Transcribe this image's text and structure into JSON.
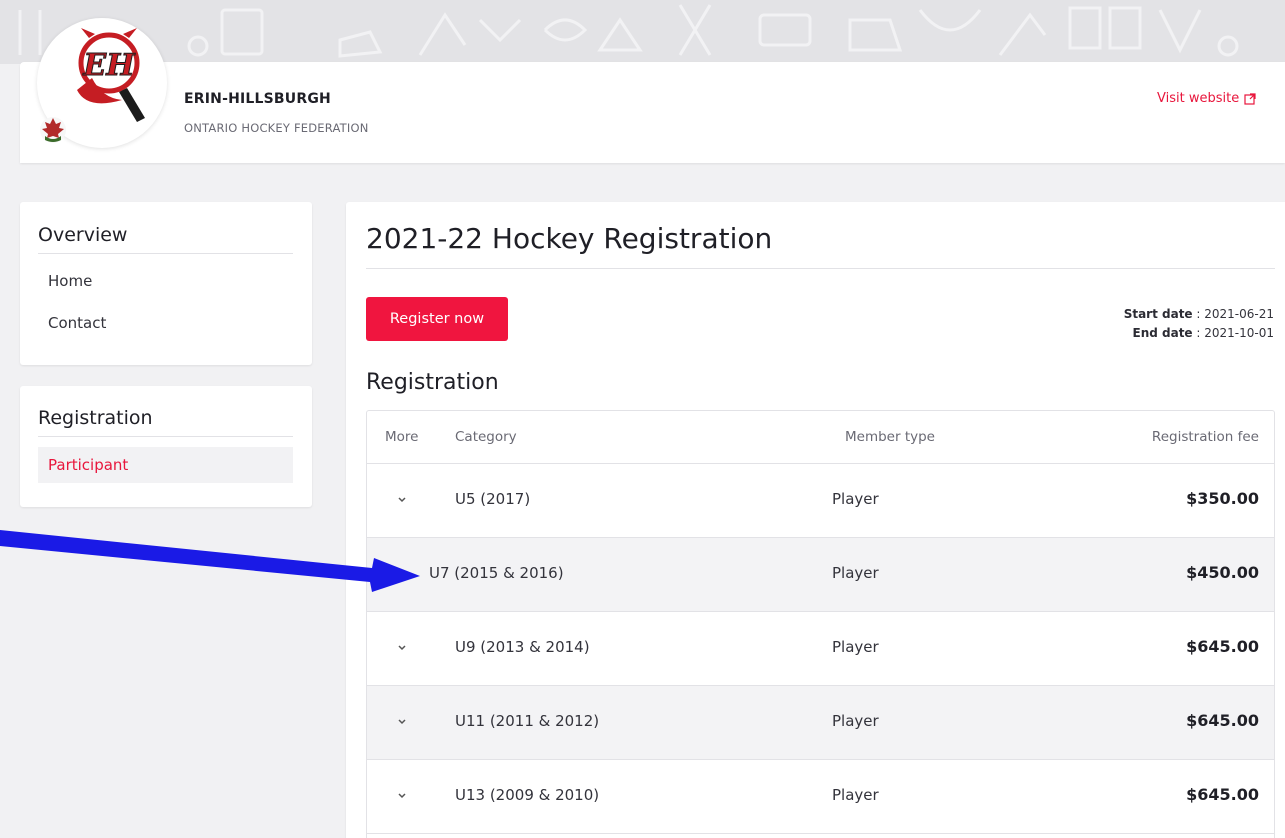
{
  "header": {
    "org_name": "ERIN-HILLSBURGH",
    "federation": "ONTARIO HOCKEY FEDERATION",
    "visit_link": "Visit website",
    "logo_text": "EH"
  },
  "sidebar": {
    "overview": {
      "title": "Overview",
      "items": [
        {
          "label": "Home"
        },
        {
          "label": "Contact"
        }
      ]
    },
    "registration": {
      "title": "Registration",
      "items": [
        {
          "label": "Participant",
          "active": true
        }
      ]
    }
  },
  "main": {
    "title": "2021-22 Hockey Registration",
    "register_button": "Register now",
    "start_label": "Start date",
    "start_value": "2021-06-21",
    "end_label": "End date",
    "end_value": "2021-10-01",
    "section_title": "Registration",
    "table": {
      "headers": {
        "more": "More",
        "category": "Category",
        "member_type": "Member type",
        "fee": "Registration fee"
      },
      "rows": [
        {
          "category": "U5 (2017)",
          "member_type": "Player",
          "fee": "$350.00",
          "has_chevron": true
        },
        {
          "category": "U7 (2015 & 2016)",
          "member_type": "Player",
          "fee": "$450.00",
          "has_chevron": false
        },
        {
          "category": "U9 (2013 & 2014)",
          "member_type": "Player",
          "fee": "$645.00",
          "has_chevron": true
        },
        {
          "category": "U11 (2011 & 2012)",
          "member_type": "Player",
          "fee": "$645.00",
          "has_chevron": true
        },
        {
          "category": "U13 (2009 & 2010)",
          "member_type": "Player",
          "fee": "$645.00",
          "has_chevron": true
        }
      ]
    }
  },
  "colors": {
    "accent": "#f0153f",
    "link": "#e8163c",
    "annotation_arrow": "#1a1ae6"
  },
  "icons": {
    "external_link": "external-link-icon",
    "row_expand": "chevron-down-icon",
    "annotation": "arrow-annotation-icon"
  }
}
